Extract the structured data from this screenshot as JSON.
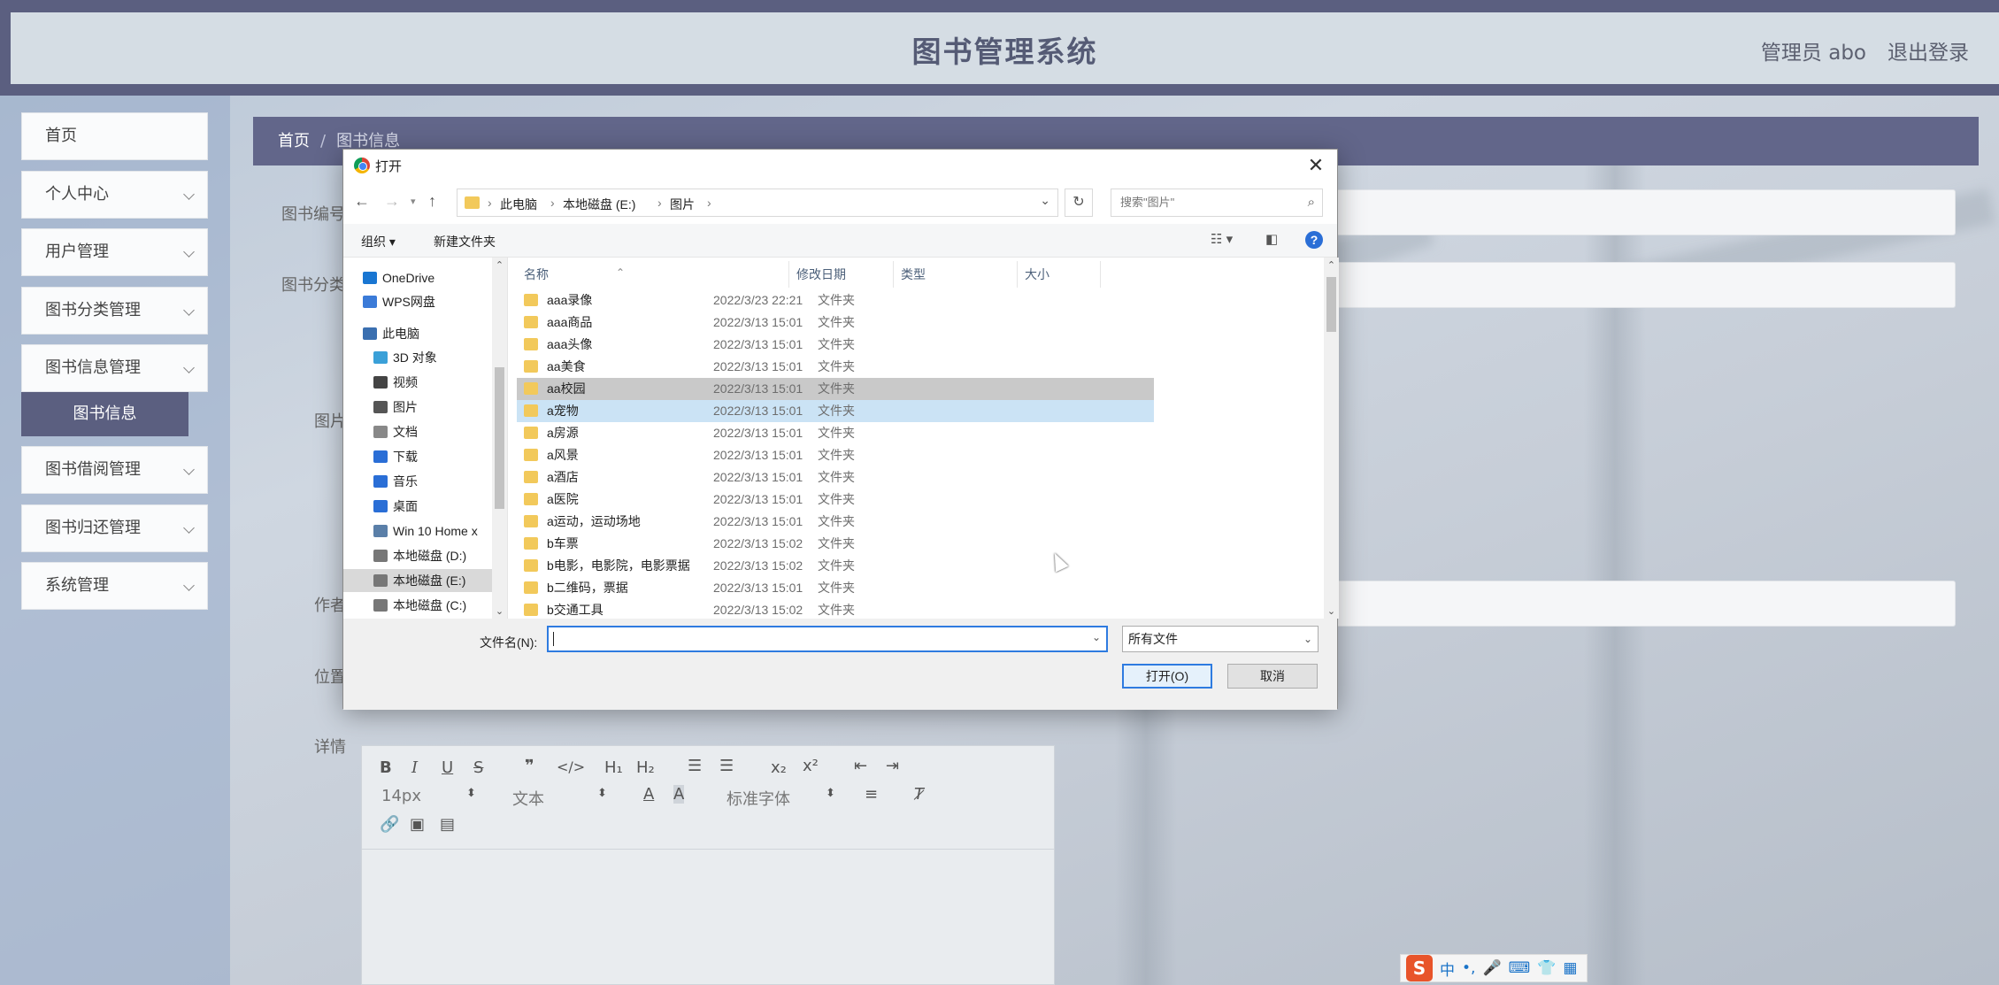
{
  "app": {
    "title": "图书管理系统",
    "user_label": "管理员 abo",
    "logout_label": "退出登录"
  },
  "sidebar": {
    "items": [
      {
        "label": "首页"
      },
      {
        "label": "个人中心"
      },
      {
        "label": "用户管理"
      },
      {
        "label": "图书分类管理"
      },
      {
        "label": "图书信息管理"
      },
      {
        "label": "图书借阅管理"
      },
      {
        "label": "图书归还管理"
      },
      {
        "label": "系统管理"
      }
    ],
    "active_sub": "图书信息"
  },
  "main": {
    "breadcrumb": {
      "home": "首页",
      "sep": "/",
      "current": "图书信息"
    },
    "labels": {
      "book_no": "图书编号",
      "category": "图书分类",
      "image": "图片",
      "author": "作者",
      "location": "位置",
      "details": "详情"
    },
    "editor": {
      "font_size": "14px",
      "block_type": "文本",
      "font_family": "标准字体"
    }
  },
  "dialog": {
    "title": "打开",
    "close_glyph": "✕",
    "address": {
      "segments": [
        "此电脑",
        "本地磁盘 (E:)",
        "图片"
      ]
    },
    "search_placeholder": "搜索\"图片\"",
    "commands": {
      "organize": "组织 ▾",
      "new_folder": "新建文件夹"
    },
    "nav_items": [
      {
        "label": "OneDrive",
        "icon": "cloud-icon",
        "color": "#1976d2"
      },
      {
        "label": "WPS网盘",
        "icon": "cloud-icon",
        "color": "#3b7bd8"
      },
      {
        "label": "此电脑",
        "icon": "computer-icon",
        "color": "#3a6fb0"
      },
      {
        "label": "3D 对象",
        "icon": "cube-icon",
        "color": "#3aa0d8"
      },
      {
        "label": "视频",
        "icon": "video-icon",
        "color": "#444"
      },
      {
        "label": "图片",
        "icon": "picture-icon",
        "color": "#555"
      },
      {
        "label": "文档",
        "icon": "document-icon",
        "color": "#888"
      },
      {
        "label": "下载",
        "icon": "download-icon",
        "color": "#2a6ed6"
      },
      {
        "label": "音乐",
        "icon": "music-icon",
        "color": "#2a6ed6"
      },
      {
        "label": "桌面",
        "icon": "desktop-icon",
        "color": "#2a6ed6"
      },
      {
        "label": "Win 10 Home x",
        "icon": "drive-icon",
        "color": "#5a7fa8"
      },
      {
        "label": "本地磁盘 (D:)",
        "icon": "drive-icon",
        "color": "#777"
      },
      {
        "label": "本地磁盘 (E:)",
        "icon": "drive-icon",
        "color": "#777"
      },
      {
        "label": "本地磁盘 (C:)",
        "icon": "drive-icon",
        "color": "#777"
      }
    ],
    "columns": {
      "name": "名称",
      "modified": "修改日期",
      "type": "类型",
      "size": "大小"
    },
    "files": [
      {
        "name": "aaa录像",
        "date": "2022/3/23 22:21",
        "type": "文件夹"
      },
      {
        "name": "aaa商品",
        "date": "2022/3/13 15:01",
        "type": "文件夹"
      },
      {
        "name": "aaa头像",
        "date": "2022/3/13 15:01",
        "type": "文件夹"
      },
      {
        "name": "aa美食",
        "date": "2022/3/13 15:01",
        "type": "文件夹"
      },
      {
        "name": "aa校园",
        "date": "2022/3/13 15:01",
        "type": "文件夹"
      },
      {
        "name": "a宠物",
        "date": "2022/3/13 15:01",
        "type": "文件夹"
      },
      {
        "name": "a房源",
        "date": "2022/3/13 15:01",
        "type": "文件夹"
      },
      {
        "name": "a风景",
        "date": "2022/3/13 15:01",
        "type": "文件夹"
      },
      {
        "name": "a酒店",
        "date": "2022/3/13 15:01",
        "type": "文件夹"
      },
      {
        "name": "a医院",
        "date": "2022/3/13 15:01",
        "type": "文件夹"
      },
      {
        "name": "a运动，运动场地",
        "date": "2022/3/13 15:01",
        "type": "文件夹"
      },
      {
        "name": "b车票",
        "date": "2022/3/13 15:02",
        "type": "文件夹"
      },
      {
        "name": "b电影，电影院，电影票据",
        "date": "2022/3/13 15:02",
        "type": "文件夹"
      },
      {
        "name": "b二维码，票据",
        "date": "2022/3/13 15:01",
        "type": "文件夹"
      },
      {
        "name": "b交通工具",
        "date": "2022/3/13 15:02",
        "type": "文件夹"
      }
    ],
    "filename_label": "文件名(N):",
    "filename_value": "",
    "filter_value": "所有文件",
    "open_label": "打开(O)",
    "cancel_label": "取消"
  },
  "ime": {
    "lang": "中",
    "logo": "S"
  }
}
